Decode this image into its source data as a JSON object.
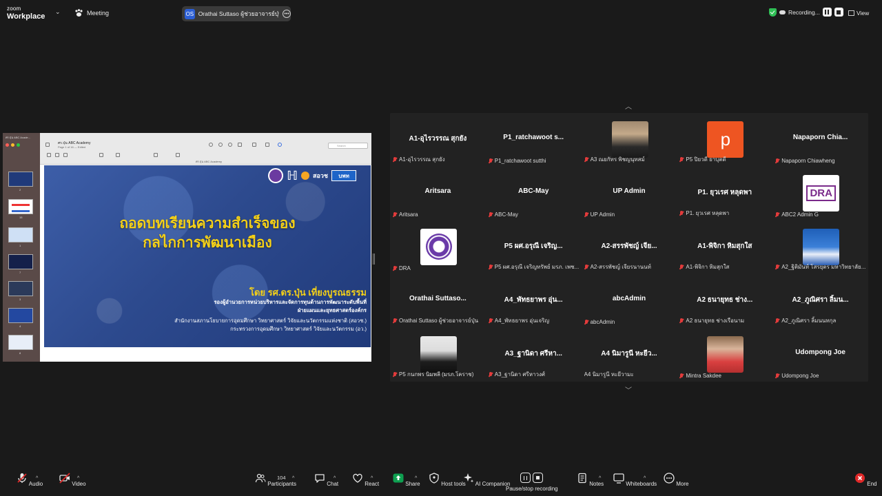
{
  "topbar": {
    "logo_small": "zoom",
    "logo_big": "Workplace",
    "meeting_label": "Meeting",
    "active_speaker": {
      "initials": "OS",
      "name": "Orathai Suttaso  ผู้ช่วยอาจารย์ปุ่น's s"
    },
    "recording_label": "Recording...",
    "view_label": "View"
  },
  "share": {
    "window_title": "ศร.ปุ่น ABC Acade...",
    "doc_title": "ศร.ปุ่น ABC Academy",
    "doc_sub": "Page 1 of 16 — Edited",
    "tab_label": "ศร.ปุ่น ABC Academy",
    "search_placeholder": "Search",
    "thumb_labels": [
      "2",
      "15",
      "1",
      "7",
      "3",
      "4",
      "8"
    ],
    "slide": {
      "title_line1": "ถอดบทเรียนความสำเร็จของ",
      "title_line2": "กลไกการพัฒนาเมือง",
      "by": "โดย รศ.ดร.ปุ่น เที่ยงบูรณธรรม",
      "line1": "รองผู้อำนวยการหน่วยบริหารและจัดการทุนด้านการพัฒนาระดับพื้นที่",
      "line2": "ฝ่ายแผนและยุทธศาสตร์องค์กร",
      "line3": "สำนักงานสภานโยบายการอุดมศึกษา วิทยาศาสตร์ วิจัยและนวัตกรรมแห่งชาติ (สอวช.)",
      "line4": "กระทรวงการอุดมศึกษา วิทยาศาสตร์ วิจัยและนวัตกรรม (อว.)",
      "logo_txt1": "สอวช",
      "logo_txt2": "บพท"
    }
  },
  "gallery": {
    "tiles": [
      {
        "big": "A1-อุไรวรรณ สุกยัง",
        "small": "A1-อุไรวรรณ สุกยัง",
        "muted": true,
        "photo": ""
      },
      {
        "big": "P1_ratchawoot  s...",
        "small": "P1_ratchawoot sutthi",
        "muted": true,
        "photo": ""
      },
      {
        "big": "",
        "small": "A3 ณยกัทร พิชญนุทสม์",
        "muted": true,
        "photo": "woman"
      },
      {
        "big": "",
        "small": "P5 ปิยวดี ยาบุตดี",
        "muted": true,
        "photo": "p-avatar",
        "avatar_letter": "p"
      },
      {
        "big": "Napaporn  Chia...",
        "small": "Napaporn Chiawheng",
        "muted": true,
        "photo": ""
      },
      {
        "big": "Aritsara",
        "small": "Aritsara",
        "muted": true,
        "photo": ""
      },
      {
        "big": "ABC-May",
        "small": "ABC-May",
        "muted": true,
        "photo": ""
      },
      {
        "big": "UP  Admin",
        "small": "UP  Admin",
        "muted": true,
        "photo": ""
      },
      {
        "big": "P1. ยุวเรศ  หลุดพา",
        "small": "P1. ยุวเรศ  หลุดพา",
        "muted": true,
        "photo": ""
      },
      {
        "big": "",
        "small": "ABC2 Admin G",
        "muted": true,
        "photo": "dra-logo",
        "avatar_letter": "DRA"
      },
      {
        "big": "",
        "small": "DRA",
        "muted": true,
        "photo": "purple-seal"
      },
      {
        "big": "P5 ผศ.อรุณี เจริญ...",
        "small": "P5 ผศ.อรุณี เจริญทรัพย์ มรภ. เพช...",
        "muted": true,
        "photo": ""
      },
      {
        "big": "A2-สรรพัชญ์ เจีย...",
        "small": "A2-สรรพัชญ์ เจียรนานนท์",
        "muted": true,
        "photo": ""
      },
      {
        "big": "A1-พิจิกา หิมสุกใส",
        "small": "A1-พิจิกา หิมสุกใส",
        "muted": true,
        "photo": ""
      },
      {
        "big": "",
        "small": "A2_ฐิติมันท์  โสรยุตร มหาวิทยาลัย...",
        "muted": true,
        "photo": "stage"
      },
      {
        "big": "Orathai  Suttaso...",
        "small": "Orathai Suttaso  ผู้ช่วยอาจารย์ปุ่น",
        "muted": true,
        "photo": ""
      },
      {
        "big": "A4_พัทธยาพร อุ่น...",
        "small": "A4_พัทธยาพร อุ่นเจริญ",
        "muted": true,
        "photo": ""
      },
      {
        "big": "abcAdmin",
        "small": "abcAdmin",
        "muted": true,
        "photo": ""
      },
      {
        "big": "A2 ธนายุทธ ช่าง...",
        "small": "A2 ธนายุทธ ช่างเรือนาม",
        "muted": true,
        "photo": ""
      },
      {
        "big": "A2_ภูณิศรา ลิ้มน...",
        "small": "A2_ภูณิศรา ลิ้มนนทกุล",
        "muted": true,
        "photo": ""
      },
      {
        "big": "",
        "small": "P5 กนกพร นิมพลี (มรภ.โคราช)",
        "muted": true,
        "photo": "woman2"
      },
      {
        "big": "A3_ฐานิดา ศรีหา...",
        "small": "A3_ฐานิดา ศรีหาวงศ์",
        "muted": true,
        "photo": ""
      },
      {
        "big": "A4 นิมารูนี หะยีว...",
        "small": "A4 นิมารูนี หะยีวามะ",
        "muted": false,
        "photo": ""
      },
      {
        "big": "",
        "small": "Mintra Sakdee",
        "muted": true,
        "photo": "woman3"
      },
      {
        "big": "Udompong Joe",
        "small": "Udompong Joe",
        "muted": true,
        "photo": ""
      }
    ]
  },
  "toolbar": {
    "audio": "Audio",
    "video": "Video",
    "participants": "Participants",
    "participants_count": "104",
    "chat": "Chat",
    "react": "React",
    "share": "Share",
    "host_tools": "Host tools",
    "ai_companion": "AI Companion",
    "pause_stop": "Pause/stop recording",
    "notes": "Notes",
    "whiteboards": "Whiteboards",
    "more": "More",
    "end": "End"
  },
  "colors": {
    "accent_share": "#0e9f50",
    "end_red": "#e02828",
    "slide_title": "#f4d018",
    "muted_mic": "#e23b3b"
  }
}
